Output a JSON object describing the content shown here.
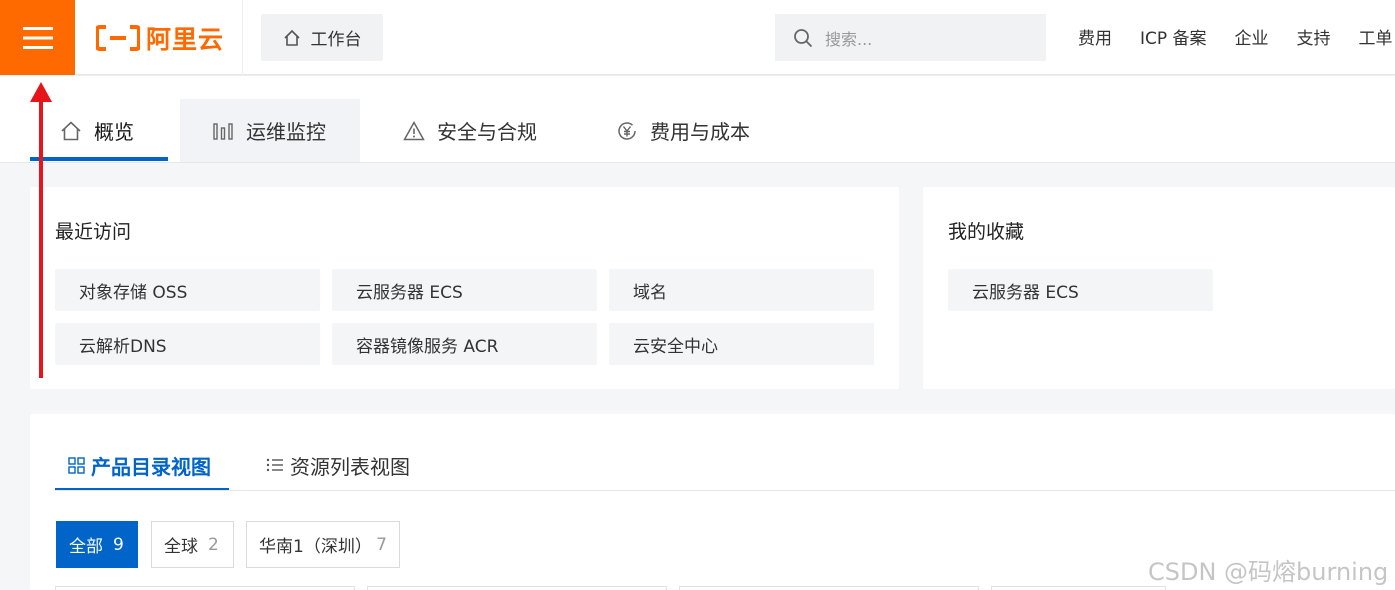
{
  "header": {
    "brand": "阿里云",
    "workbench_label": "工作台",
    "search_placeholder": "搜索...",
    "links": [
      "费用",
      "ICP 备案",
      "企业",
      "支持",
      "工单"
    ]
  },
  "tabs": [
    {
      "label": "概览",
      "icon": "home-icon",
      "active": true
    },
    {
      "label": "运维监控",
      "icon": "bar-chart-icon",
      "active": false
    },
    {
      "label": "安全与合规",
      "icon": "warning-icon",
      "active": false
    },
    {
      "label": "费用与成本",
      "icon": "yen-icon",
      "active": false
    }
  ],
  "recent": {
    "title": "最近访问",
    "items": [
      "对象存储 OSS",
      "云服务器 ECS",
      "域名",
      "云解析DNS",
      "容器镜像服务 ACR",
      "云安全中心"
    ]
  },
  "favorites": {
    "title": "我的收藏",
    "items": [
      "云服务器 ECS"
    ]
  },
  "views": {
    "catalog_label": "产品目录视图",
    "list_label": "资源列表视图"
  },
  "filters": [
    {
      "label": "全部",
      "count": "9",
      "active": true
    },
    {
      "label": "全球",
      "count": "2",
      "active": false
    },
    {
      "label": "华南1（深圳）",
      "count": "7",
      "active": false
    }
  ],
  "watermark": "CSDN @码熔burning",
  "colors": {
    "brand": "#ff6a00",
    "primary": "#0064c8",
    "annotation_arrow": "#e8141b"
  }
}
